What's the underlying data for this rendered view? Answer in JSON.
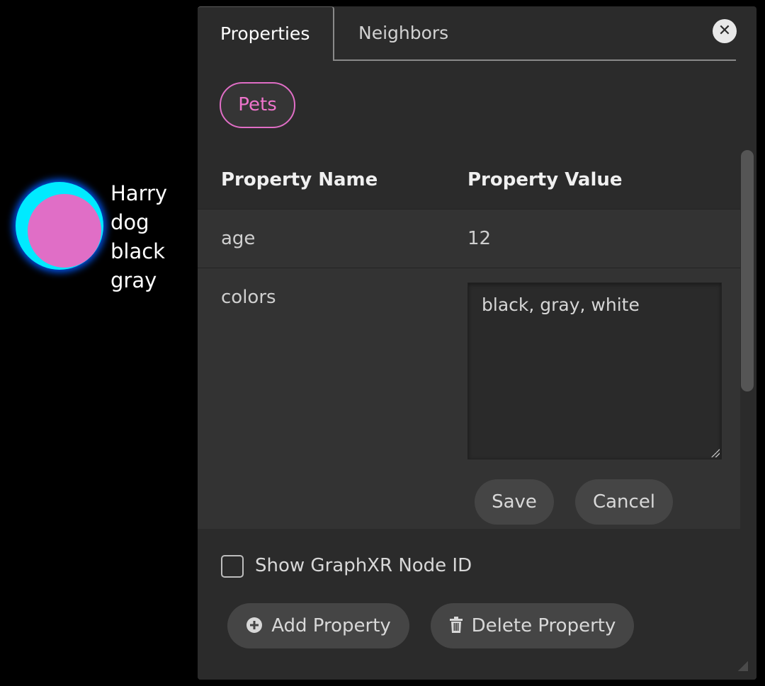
{
  "graph": {
    "node": {
      "ring_color": "#00eaff",
      "fill_color": "#e06ec6",
      "labels": [
        "Harry",
        "dog",
        "black",
        "gray"
      ]
    }
  },
  "panel": {
    "tabs": [
      {
        "label": "Properties",
        "active": true
      },
      {
        "label": "Neighbors",
        "active": false
      }
    ],
    "close_icon": "close-icon",
    "category_tag": {
      "label": "Pets",
      "color": "#e06ec6"
    },
    "table": {
      "headers": {
        "name": "Property Name",
        "value": "Property Value"
      },
      "rows": [
        {
          "name": "age",
          "value": "12"
        },
        {
          "name": "colors",
          "value": "black, gray, white",
          "editing": true
        }
      ]
    },
    "edit_actions": {
      "save_label": "Save",
      "cancel_label": "Cancel"
    },
    "show_node_id": {
      "label": "Show GraphXR Node ID",
      "checked": false
    },
    "actions": {
      "add_label": "Add Property",
      "add_icon": "plus-circle-icon",
      "delete_label": "Delete Property",
      "delete_icon": "trash-icon"
    }
  }
}
